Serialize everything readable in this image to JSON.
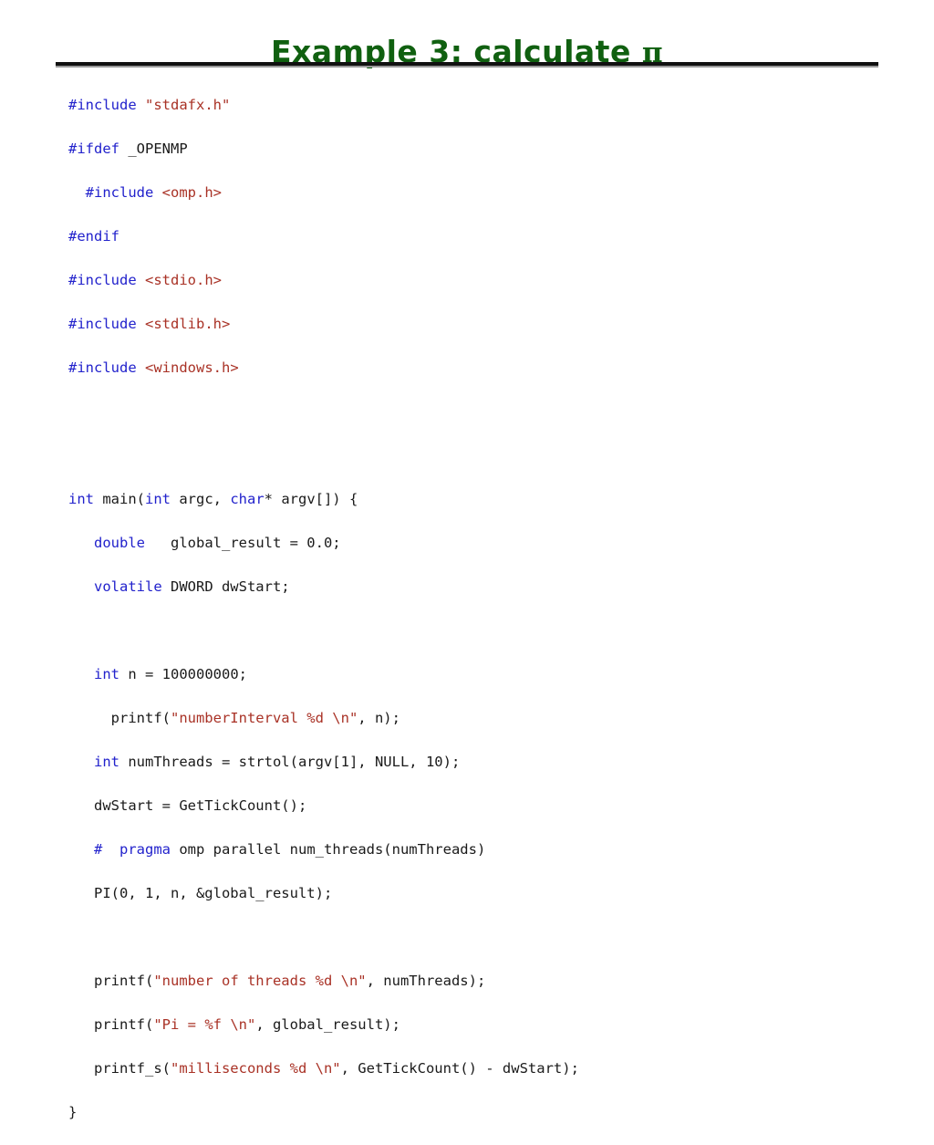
{
  "slide": {
    "title_text": "Example 3: calculate ",
    "title_symbol": "π",
    "title_color": "#106010",
    "background_color": "#ffffff",
    "divider_color": "#111111",
    "divider_shadow_color": "#999999"
  },
  "syntax_colors": {
    "preprocessor": "#2222cc",
    "keyword": "#2222cc",
    "string": "#a93226",
    "plain": "#1a1a1a"
  },
  "code": {
    "language": "c",
    "lines": [
      {
        "id": "l1",
        "segments": [
          {
            "t": "#include",
            "c": "pre"
          },
          {
            "t": " ",
            "c": "plain"
          },
          {
            "t": "\"stdafx.h\"",
            "c": "str"
          }
        ]
      },
      {
        "id": "l2",
        "segments": [
          {
            "t": "#ifdef",
            "c": "pre"
          },
          {
            "t": " _OPENMP",
            "c": "plain"
          }
        ]
      },
      {
        "id": "l3",
        "segments": [
          {
            "t": "  ",
            "c": "plain"
          },
          {
            "t": "#include",
            "c": "pre"
          },
          {
            "t": " ",
            "c": "plain"
          },
          {
            "t": "<omp.h>",
            "c": "str"
          }
        ]
      },
      {
        "id": "l4",
        "segments": [
          {
            "t": "#endif",
            "c": "pre"
          }
        ]
      },
      {
        "id": "l5",
        "segments": [
          {
            "t": "#include",
            "c": "pre"
          },
          {
            "t": " ",
            "c": "plain"
          },
          {
            "t": "<stdio.h>",
            "c": "str"
          }
        ]
      },
      {
        "id": "l6",
        "segments": [
          {
            "t": "#include",
            "c": "pre"
          },
          {
            "t": " ",
            "c": "plain"
          },
          {
            "t": "<stdlib.h>",
            "c": "str"
          }
        ]
      },
      {
        "id": "l7",
        "segments": [
          {
            "t": "#include",
            "c": "pre"
          },
          {
            "t": " ",
            "c": "plain"
          },
          {
            "t": "<windows.h>",
            "c": "str"
          }
        ]
      },
      {
        "id": "l8",
        "segments": []
      },
      {
        "id": "l9",
        "segments": []
      },
      {
        "id": "l10",
        "segments": [
          {
            "t": "int",
            "c": "kw"
          },
          {
            "t": " main(",
            "c": "plain"
          },
          {
            "t": "int",
            "c": "kw"
          },
          {
            "t": " argc, ",
            "c": "plain"
          },
          {
            "t": "char",
            "c": "kw"
          },
          {
            "t": "* argv[]) {",
            "c": "plain"
          }
        ]
      },
      {
        "id": "l11",
        "segments": [
          {
            "t": "   ",
            "c": "plain"
          },
          {
            "t": "double",
            "c": "kw"
          },
          {
            "t": "   global_result = 0.0;",
            "c": "plain"
          }
        ]
      },
      {
        "id": "l12",
        "segments": [
          {
            "t": "   ",
            "c": "plain"
          },
          {
            "t": "volatile",
            "c": "kw"
          },
          {
            "t": " DWORD dwStart;",
            "c": "plain"
          }
        ]
      },
      {
        "id": "l13",
        "segments": []
      },
      {
        "id": "l14",
        "segments": [
          {
            "t": "   ",
            "c": "plain"
          },
          {
            "t": "int",
            "c": "kw"
          },
          {
            "t": " n = 100000000;",
            "c": "plain"
          }
        ]
      },
      {
        "id": "l15",
        "segments": [
          {
            "t": "     printf(",
            "c": "plain"
          },
          {
            "t": "\"numberInterval %d \\n\"",
            "c": "str"
          },
          {
            "t": ", n);",
            "c": "plain"
          }
        ]
      },
      {
        "id": "l16",
        "segments": [
          {
            "t": "   ",
            "c": "plain"
          },
          {
            "t": "int",
            "c": "kw"
          },
          {
            "t": " numThreads = strtol(argv[1], NULL, 10);",
            "c": "plain"
          }
        ]
      },
      {
        "id": "l17",
        "segments": [
          {
            "t": "   dwStart = GetTickCount();",
            "c": "plain"
          }
        ]
      },
      {
        "id": "l18",
        "segments": [
          {
            "t": "   ",
            "c": "plain"
          },
          {
            "t": "#",
            "c": "pre"
          },
          {
            "t": "  ",
            "c": "plain"
          },
          {
            "t": "pragma",
            "c": "pre"
          },
          {
            "t": " omp parallel num_threads(numThreads)",
            "c": "plain"
          }
        ]
      },
      {
        "id": "l19",
        "segments": [
          {
            "t": "   PI(0, 1, n, &global_result);",
            "c": "plain"
          }
        ]
      },
      {
        "id": "l20",
        "segments": []
      },
      {
        "id": "l21",
        "segments": [
          {
            "t": "   printf(",
            "c": "plain"
          },
          {
            "t": "\"number of threads %d \\n\"",
            "c": "str"
          },
          {
            "t": ", numThreads);",
            "c": "plain"
          }
        ]
      },
      {
        "id": "l22",
        "segments": [
          {
            "t": "   printf(",
            "c": "plain"
          },
          {
            "t": "\"Pi = %f \\n\"",
            "c": "str"
          },
          {
            "t": ", global_result);",
            "c": "plain"
          }
        ]
      },
      {
        "id": "l23",
        "segments": [
          {
            "t": "   printf_s(",
            "c": "plain"
          },
          {
            "t": "\"milliseconds %d \\n\"",
            "c": "str"
          },
          {
            "t": ", GetTickCount() - dwStart);",
            "c": "plain"
          }
        ]
      },
      {
        "id": "l24",
        "segments": [
          {
            "t": "}",
            "c": "plain"
          }
        ]
      }
    ]
  }
}
